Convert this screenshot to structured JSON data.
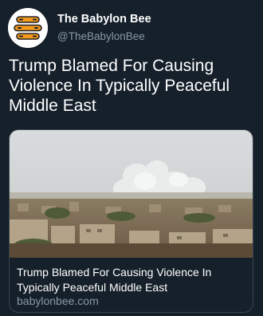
{
  "account": {
    "display_name": "The Babylon Bee",
    "handle": "@TheBabylonBee",
    "avatar_icon": "babylon-bee-logo-icon"
  },
  "tweet": {
    "text": "Trump Blamed For Causing Violence In Typically Peaceful Middle East"
  },
  "link_card": {
    "image_icon": "smoke-over-city-photo",
    "title": "Trump Blamed For Causing Violence In Typically Peaceful Middle East",
    "domain": "babylonbee.com"
  },
  "colors": {
    "background": "#15202b",
    "text_primary": "#ffffff",
    "text_secondary": "#8899a6",
    "card_border": "#38444d",
    "logo_orange": "#f39a1e"
  }
}
